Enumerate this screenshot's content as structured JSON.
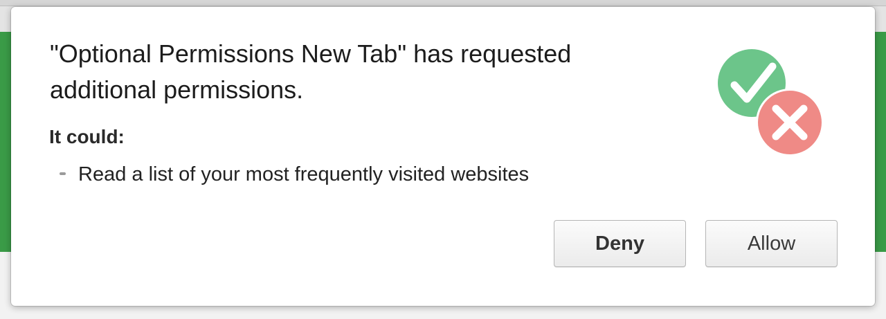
{
  "dialog": {
    "title": "\"Optional Permissions New Tab\" has requested additional permissions.",
    "subheading": "It could:",
    "permissions": [
      "Read a list of your most frequently visited websites"
    ],
    "icon": "permission-allow-deny-icon",
    "colors": {
      "check_green": "#6cc58a",
      "cross_red": "#ef8a86"
    }
  },
  "buttons": {
    "deny_label": "Deny",
    "allow_label": "Allow"
  },
  "background": {
    "accent_green": "#3a9b47"
  }
}
